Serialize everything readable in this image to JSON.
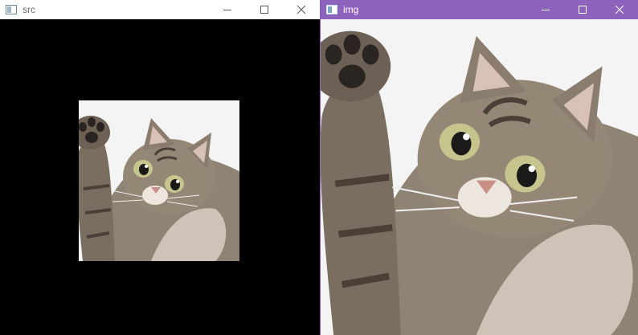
{
  "windows": {
    "src": {
      "title": "src"
    },
    "img": {
      "title": "img"
    }
  },
  "icons": {
    "app": "app-window-icon",
    "minimize": "minimize-icon",
    "maximize": "maximize-icon",
    "close": "close-icon"
  },
  "colors": {
    "src_canvas": "#000000",
    "img_titlebar": "#8d63bd",
    "photo_background": "#f4f4f4"
  }
}
